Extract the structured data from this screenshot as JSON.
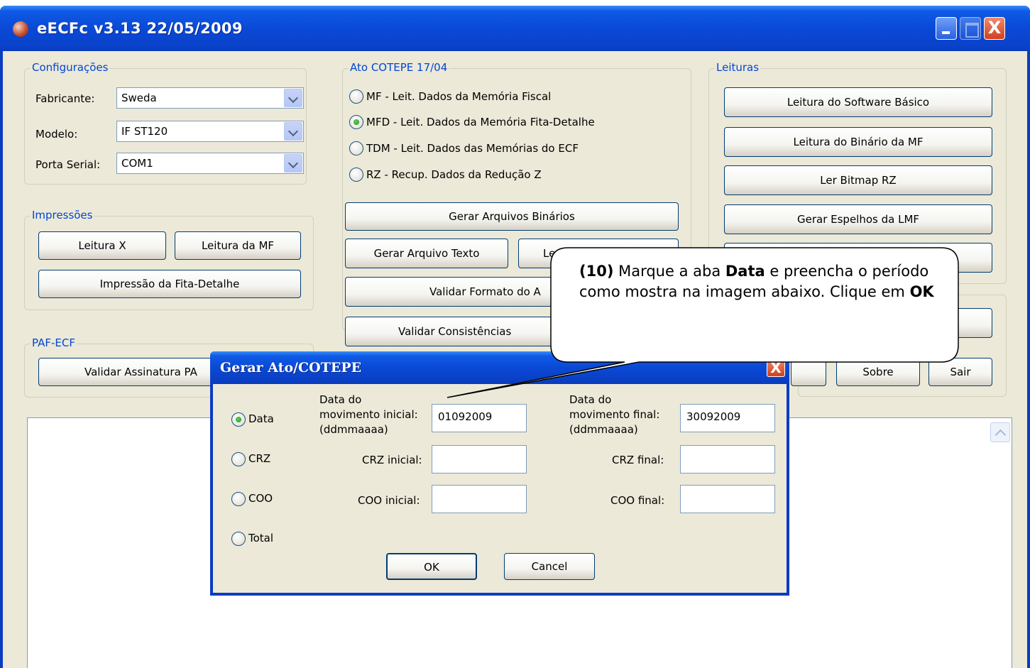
{
  "window": {
    "title": "eECFc v3.13   22/05/2009",
    "controls": {
      "minimize": "",
      "maximize": "",
      "close": "X"
    }
  },
  "configuracoes": {
    "legend": "Configurações",
    "fabricante_label": "Fabricante:",
    "fabricante_value": "Sweda",
    "modelo_label": "Modelo:",
    "modelo_value": "IF ST120",
    "porta_label": "Porta Serial:",
    "porta_value": "COM1"
  },
  "impressoes": {
    "legend": "Impressões",
    "leitura_x": "Leitura X",
    "leitura_mf": "Leitura da MF",
    "fita_detalhe": "Impressão da Fita-Detalhe"
  },
  "paf_ecf": {
    "legend": "PAF-ECF",
    "validar_assinatura": "Validar Assinatura PA"
  },
  "ato_cotepe": {
    "legend": "Ato COTEPE 17/04",
    "options": [
      {
        "label": "MF - Leit. Dados da Memória Fiscal",
        "selected": false
      },
      {
        "label": "MFD - Leit. Dados da Memória Fita-Detalhe",
        "selected": true
      },
      {
        "label": "TDM - Leit. Dados das Memórias do ECF",
        "selected": false
      },
      {
        "label": "RZ - Recup. Dados da Redução Z",
        "selected": false
      }
    ],
    "gerar_binarios": "Gerar Arquivos Binários",
    "gerar_texto": "Gerar Arquivo Texto",
    "ler_partial": "Ler P",
    "validar_formato": "Validar Formato do A",
    "validar_consistencias": "Validar Consistências"
  },
  "leituras": {
    "legend": "Leituras",
    "software_basico": "Leitura do Software Básico",
    "binario_mf": "Leitura do Binário da MF",
    "bitmap_rz": "Ler Bitmap RZ",
    "espelhos_lmf": "Gerar Espelhos da LMF"
  },
  "bottom_buttons": {
    "sobre": "Sobre",
    "sair": "Sair"
  },
  "dialog": {
    "title": "Gerar Ato/COTEPE",
    "close": "X",
    "radios": [
      {
        "label": "Data",
        "selected": true
      },
      {
        "label": "CRZ",
        "selected": false
      },
      {
        "label": "COO",
        "selected": false
      },
      {
        "label": "Total",
        "selected": false
      }
    ],
    "data_inicial_label_1": "Data do",
    "data_inicial_label_2": "movimento inicial:",
    "data_inicial_label_3": "(ddmmaaaa)",
    "data_inicial_value": "01092009",
    "data_final_label_1": "Data do",
    "data_final_label_2": "movimento final:",
    "data_final_label_3": "(ddmmaaaa)",
    "data_final_value": "30092009",
    "crz_inicial_label": "CRZ inicial:",
    "crz_inicial_value": "",
    "crz_final_label": "CRZ final:",
    "crz_final_value": "",
    "coo_inicial_label": "COO inicial:",
    "coo_inicial_value": "",
    "coo_final_label": "COO final:",
    "coo_final_value": "",
    "ok": "OK",
    "cancel": "Cancel"
  },
  "callout": {
    "step": "(10)",
    "t1": " Marque a aba ",
    "b1": "Data",
    "t2": " e preencha o período como mostra na imagem abaixo. Clique em ",
    "b2": "OK"
  }
}
